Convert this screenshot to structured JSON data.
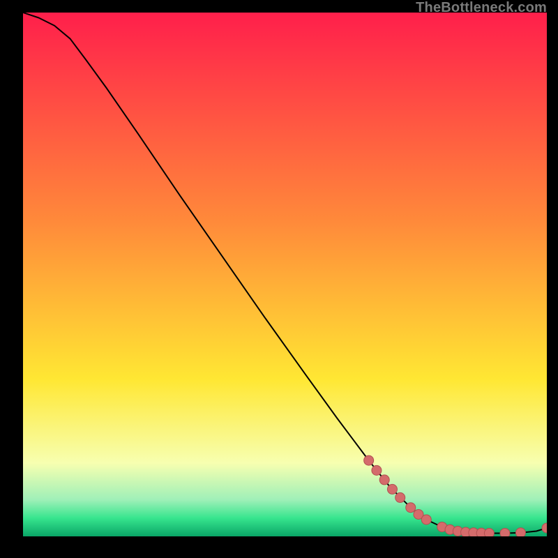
{
  "watermark": "TheBottleneck.com",
  "colors": {
    "gradient_top": "#ff1f4b",
    "gradient_yellow": "#ffe733",
    "gradient_pale": "#f7ffb0",
    "gradient_mint": "#37e58e",
    "gradient_bottom": "#0aa667",
    "curve": "#000000",
    "marker_fill": "#d46b6b",
    "marker_stroke": "#b15050",
    "black": "#000000"
  },
  "chart_data": {
    "type": "line",
    "title": "",
    "xlabel": "",
    "ylabel": "",
    "xlim": [
      0,
      100
    ],
    "ylim": [
      0,
      100
    ],
    "grid": false,
    "legend": false,
    "series": [
      {
        "name": "bottleneck-curve",
        "x": [
          0,
          3,
          6,
          9,
          12,
          16,
          22,
          30,
          38,
          46,
          54,
          60,
          66,
          70,
          74,
          77,
          80,
          83,
          86,
          89,
          92,
          95,
          98,
          100
        ],
        "y": [
          100,
          99,
          97.5,
          95,
          91,
          85.5,
          76.8,
          65,
          53.5,
          42,
          30.8,
          22.5,
          14.5,
          9.5,
          5.5,
          3.2,
          1.8,
          1.0,
          0.7,
          0.6,
          0.6,
          0.7,
          1.0,
          1.6
        ]
      }
    ],
    "markers": {
      "name": "highlighted-points",
      "x": [
        66,
        67.5,
        69,
        70.5,
        72,
        74,
        75.5,
        77,
        80,
        81.5,
        83,
        84.5,
        86,
        87.5,
        89,
        92,
        95,
        100
      ],
      "y": [
        14.5,
        12.6,
        10.8,
        9.0,
        7.4,
        5.5,
        4.2,
        3.2,
        1.8,
        1.3,
        1.0,
        0.8,
        0.7,
        0.65,
        0.6,
        0.6,
        0.7,
        1.6
      ]
    },
    "gradient_stops": [
      {
        "offset": 0.0,
        "color": "#ff1f4b"
      },
      {
        "offset": 0.4,
        "color": "#ff8a3a"
      },
      {
        "offset": 0.7,
        "color": "#ffe733"
      },
      {
        "offset": 0.86,
        "color": "#f7ffb0"
      },
      {
        "offset": 0.93,
        "color": "#9ff0b8"
      },
      {
        "offset": 0.965,
        "color": "#37e58e"
      },
      {
        "offset": 1.0,
        "color": "#0aa667"
      }
    ]
  }
}
